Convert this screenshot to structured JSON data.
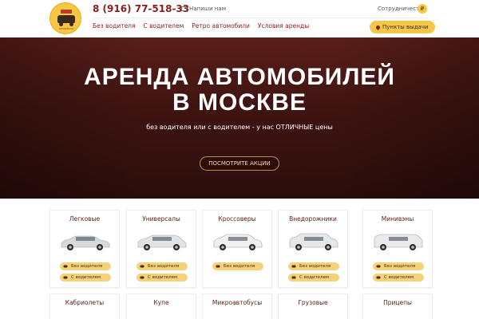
{
  "header": {
    "logo_text": "amavto.su",
    "phone": "8 (916) 77-518-33",
    "write_us": "Напиши нам",
    "cooperation": "Сотрудничество",
    "currency_badge": "₽",
    "nav": [
      "Без водителя",
      "С водителем",
      "Ретро автомобили",
      "Условия аренды"
    ],
    "pickup": "Пункты выдачи"
  },
  "hero": {
    "title_line1": "АРЕНДА АВТОМОБИЛЕЙ",
    "title_line2": "В МОСКВЕ",
    "subtitle": "без водителя или с водителем - у нас ОТЛИЧНЫЕ цены",
    "button": "ПОСМОТРИТЕ АКЦИИ"
  },
  "categories": [
    {
      "title": "Легковые",
      "pills": [
        "Без водителя",
        "С водителем"
      ],
      "car_color": "#d9dadc",
      "body": "sedan"
    },
    {
      "title": "Универсалы",
      "pills": [
        "Без водителя",
        "С водителем"
      ],
      "car_color": "#e2e3e5",
      "body": "wagon"
    },
    {
      "title": "Кроссоверы",
      "pills": [
        "Без водителя"
      ],
      "car_color": "#f0f0f0",
      "body": "crossover"
    },
    {
      "title": "Внедорожники",
      "pills": [
        "Без водителя",
        "С водителем"
      ],
      "car_color": "#e6e7e9",
      "body": "suv"
    },
    {
      "title": "Минивэны",
      "pills": [
        "Без водителя",
        "С водителем"
      ],
      "car_color": "#eaeaec",
      "body": "van"
    },
    {
      "title": "Кабриолеты"
    },
    {
      "title": "Купе"
    },
    {
      "title": "Микроавтобусы"
    },
    {
      "title": "Грузовые"
    },
    {
      "title": "Прицепы"
    }
  ],
  "colors": {
    "accent_dark": "#8b1d1d",
    "pill_yellow": "#f5d27a",
    "hero_bg": "#3f1411"
  }
}
